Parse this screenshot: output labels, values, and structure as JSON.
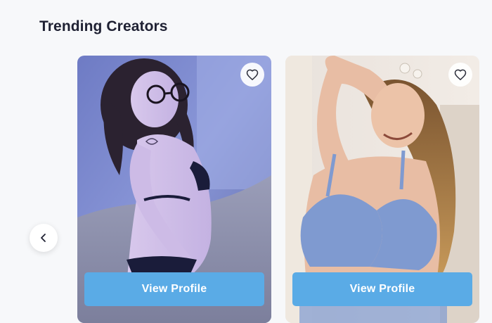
{
  "section": {
    "title": "Trending Creators"
  },
  "carousel": {
    "prev_icon": "chevron-left-icon"
  },
  "cards": [
    {
      "favorite_icon": "heart-outline-icon",
      "button_label": "View Profile"
    },
    {
      "favorite_icon": "heart-outline-icon",
      "button_label": "View Profile"
    }
  ],
  "colors": {
    "background": "#f7f8fa",
    "title": "#1f2133",
    "button": "#5aabe6",
    "button_text": "#ffffff"
  }
}
